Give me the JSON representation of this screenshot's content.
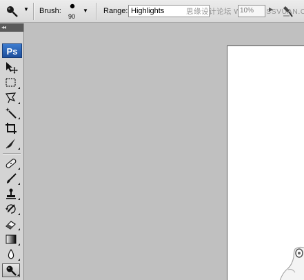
{
  "options_bar": {
    "tool_preset_icon": "dodge-tool-icon",
    "brush_label": "Brush:",
    "brush_size": "90",
    "range_label": "Range:",
    "range_value": "Highlights",
    "watermark": "思缘设计论坛  WWW.MISSVUAN.COM",
    "exposure_value": "10%",
    "airbrush_icon": "airbrush-icon"
  },
  "toolbox": {
    "header": "◂◂",
    "logo": "Ps",
    "tools": [
      {
        "name": "move-tool",
        "icon": "move-icon"
      },
      {
        "name": "marquee-tool",
        "icon": "rectangular-marquee-icon"
      },
      {
        "name": "lasso-tool",
        "icon": "polygonal-lasso-icon"
      },
      {
        "name": "magic-wand-tool",
        "icon": "magic-wand-icon"
      },
      {
        "name": "crop-tool",
        "icon": "crop-icon"
      },
      {
        "name": "slice-tool",
        "icon": "slice-icon"
      },
      {
        "name": "healing-brush-tool",
        "icon": "bandage-icon"
      },
      {
        "name": "brush-tool",
        "icon": "brush-icon"
      },
      {
        "name": "clone-stamp-tool",
        "icon": "stamp-icon"
      },
      {
        "name": "history-brush-tool",
        "icon": "history-brush-icon"
      },
      {
        "name": "eraser-tool",
        "icon": "eraser-icon"
      },
      {
        "name": "gradient-tool",
        "icon": "gradient-icon"
      },
      {
        "name": "blur-tool",
        "icon": "blur-icon"
      },
      {
        "name": "dodge-tool",
        "icon": "dodge-icon",
        "active": true
      }
    ]
  },
  "colors": {
    "workspace": "#c0c0c0",
    "canvas": "#ffffff",
    "logo_blue": "#2a5fb0"
  }
}
